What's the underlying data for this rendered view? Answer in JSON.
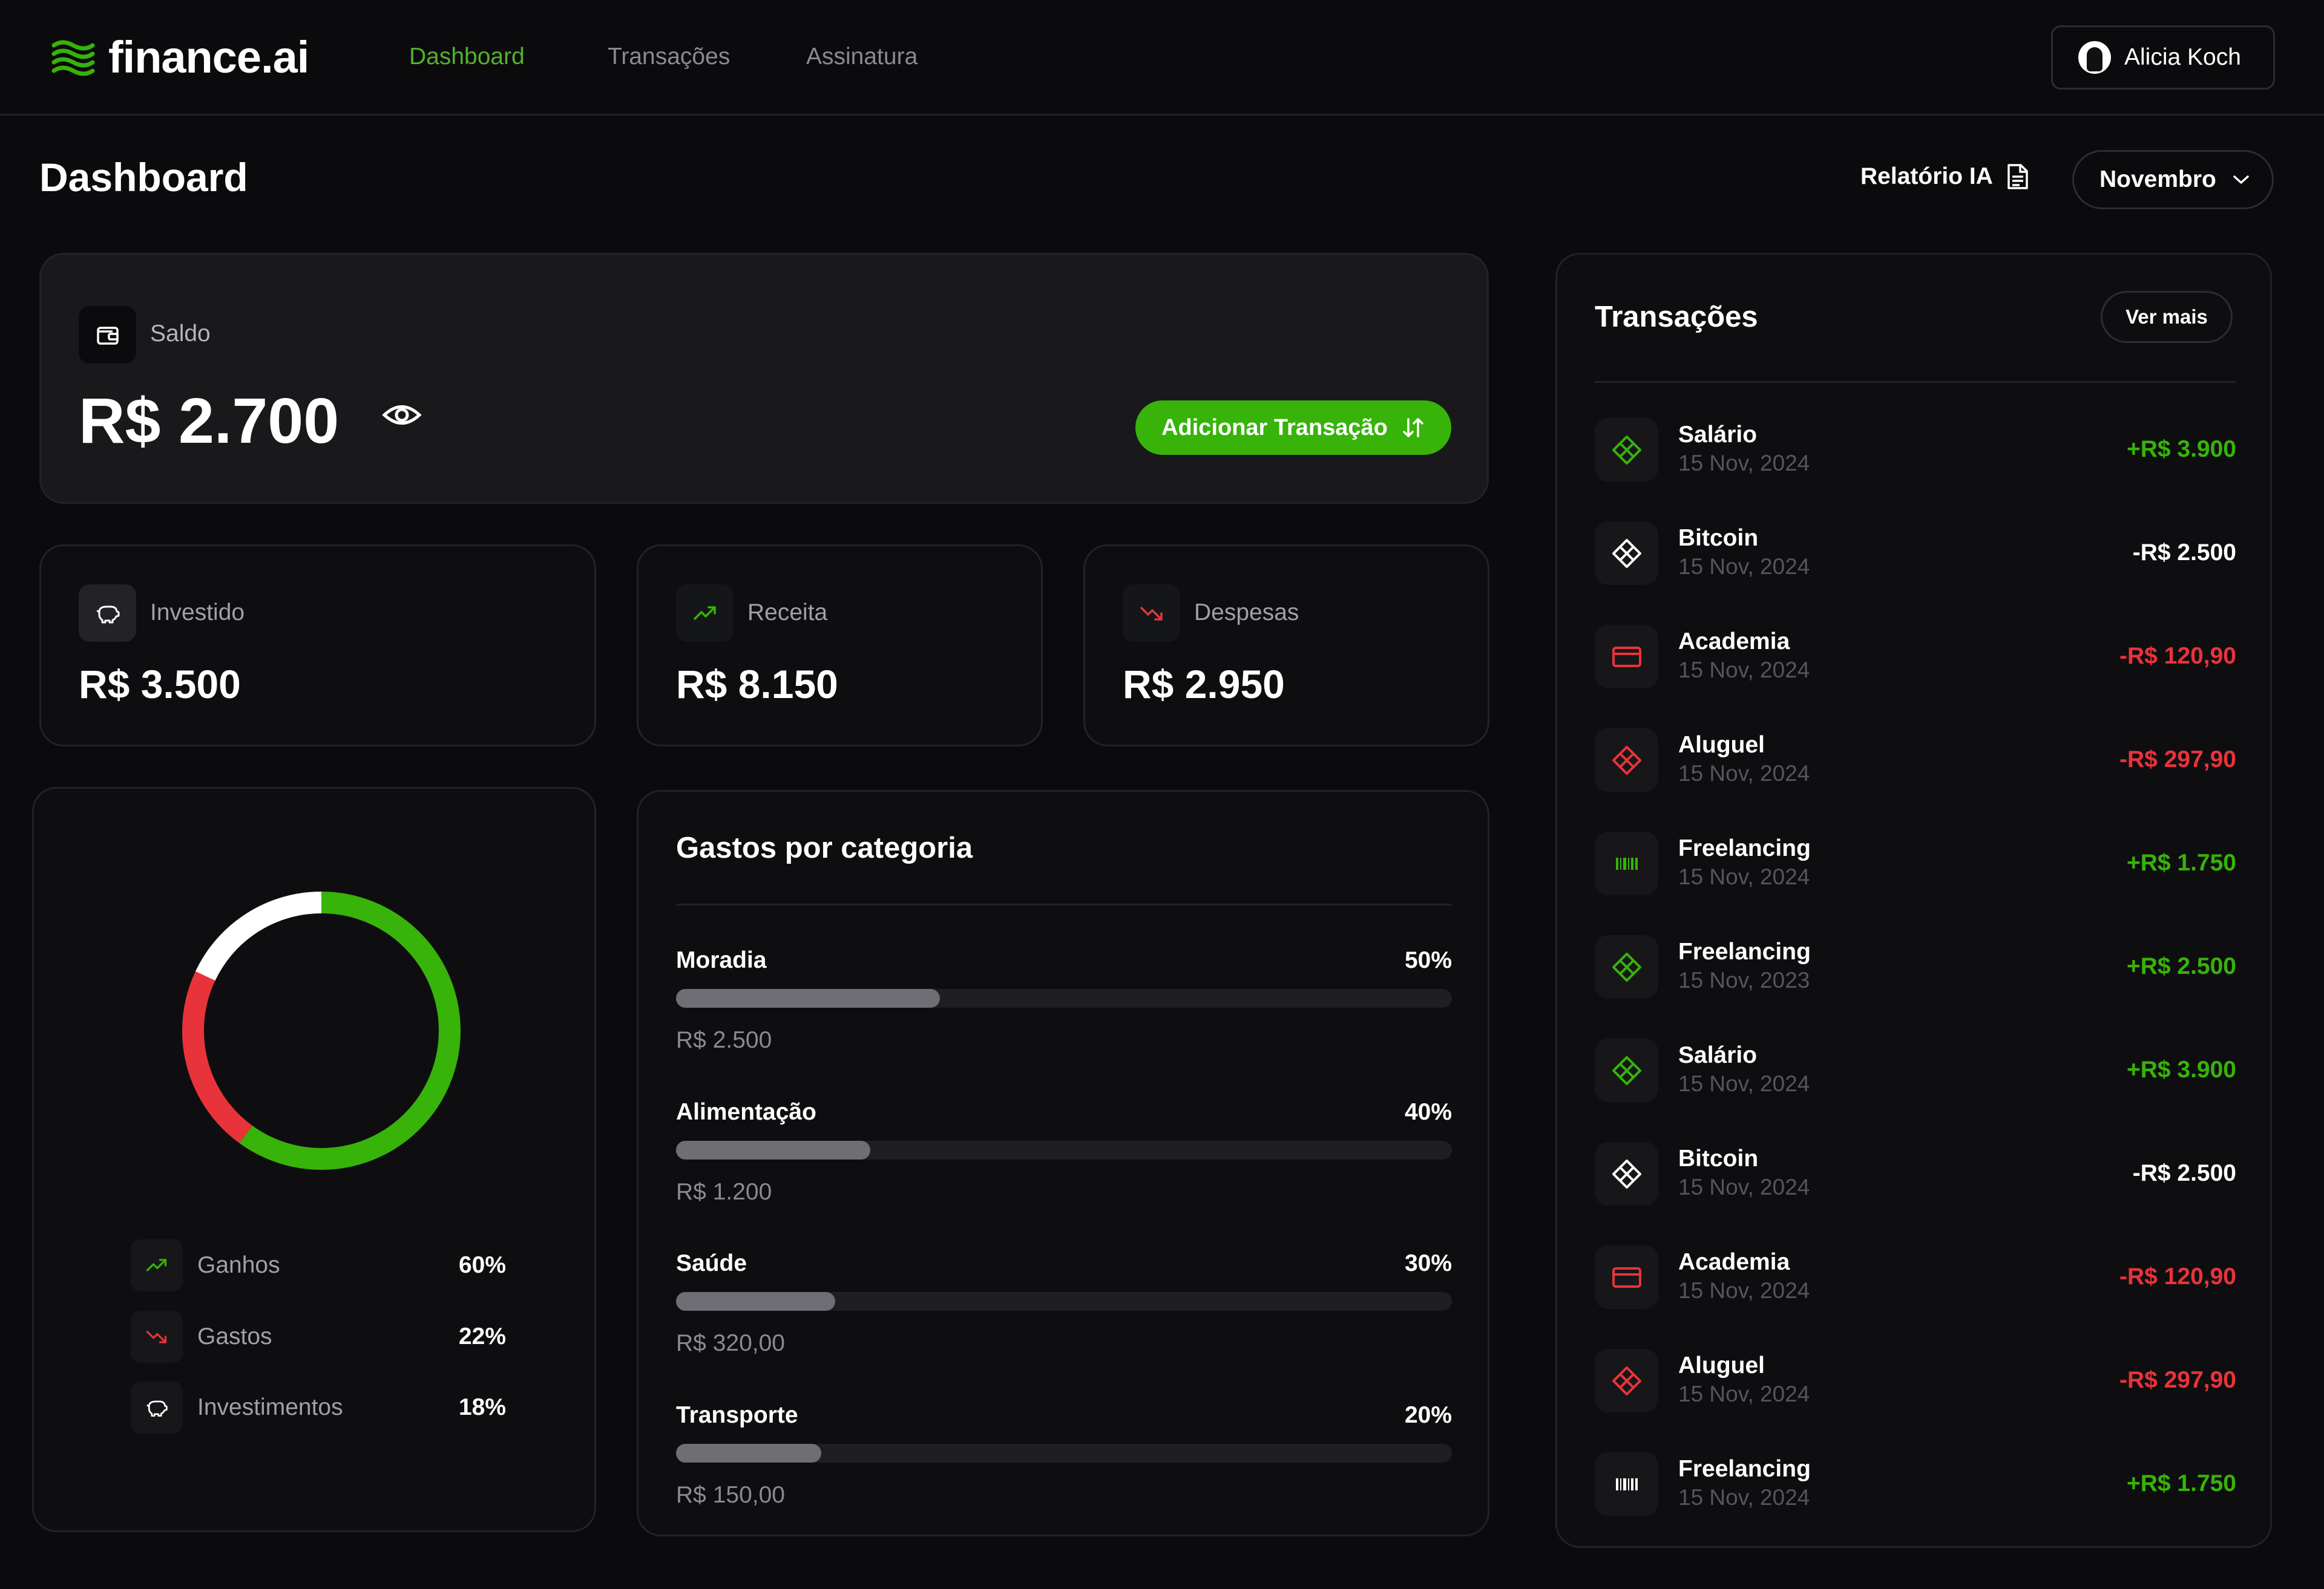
{
  "nav": {
    "logo": "finance.ai",
    "links": [
      "Dashboard",
      "Transações",
      "Assinatura"
    ],
    "user": "Alicia Koch"
  },
  "header": {
    "title": "Dashboard",
    "report_label": "Relatório IA",
    "month": "Novembro"
  },
  "balance": {
    "label": "Saldo",
    "value": "R$ 2.700",
    "add_button": "Adicionar Transação"
  },
  "stats": [
    {
      "label": "Investido",
      "value": "R$ 3.500",
      "icon": "piggy-bank-icon"
    },
    {
      "label": "Receita",
      "value": "R$ 8.150",
      "icon": "trending-up-icon"
    },
    {
      "label": "Despesas",
      "value": "R$ 2.950",
      "icon": "trending-down-icon"
    }
  ],
  "distribution": {
    "legend": [
      {
        "label": "Ganhos",
        "value": "60%"
      },
      {
        "label": "Gastos",
        "value": "22%"
      },
      {
        "label": "Investimentos",
        "value": "18%"
      }
    ]
  },
  "chart_data": {
    "type": "pie",
    "style": "donut",
    "categories": [
      "Ganhos",
      "Gastos",
      "Investimentos"
    ],
    "values": [
      60,
      22,
      18
    ],
    "colors": [
      "#37b30a",
      "#e9333a",
      "#ffffff"
    ]
  },
  "categories": {
    "title": "Gastos por categoria",
    "items": [
      {
        "name": "Moradia",
        "percent": "50%",
        "amount": "R$ 2.500",
        "fill": 0.34
      },
      {
        "name": "Alimentação",
        "percent": "40%",
        "amount": "R$ 1.200",
        "fill": 0.25
      },
      {
        "name": "Saúde",
        "percent": "30%",
        "amount": "R$ 320,00",
        "fill": 0.205
      },
      {
        "name": "Transporte",
        "percent": "20%",
        "amount": "R$ 150,00",
        "fill": 0.187
      }
    ]
  },
  "transactions": {
    "title": "Transações",
    "more": "Ver mais",
    "items": [
      {
        "name": "Salário",
        "date": "15 Nov, 2024",
        "amount": "+R$ 3.900",
        "kind": "pix",
        "color": "#37b30a"
      },
      {
        "name": "Bitcoin",
        "date": "15 Nov, 2024",
        "amount": "-R$ 2.500",
        "kind": "pix",
        "color": "#ffffff"
      },
      {
        "name": "Academia",
        "date": "15 Nov, 2024",
        "amount": "-R$ 120,90",
        "kind": "card",
        "color": "#e9333a"
      },
      {
        "name": "Aluguel",
        "date": "15 Nov, 2024",
        "amount": "-R$ 297,90",
        "kind": "pix",
        "color": "#e9333a"
      },
      {
        "name": "Freelancing",
        "date": "15 Nov, 2024",
        "amount": "+R$ 1.750",
        "kind": "barcode",
        "color": "#37b30a"
      },
      {
        "name": "Freelancing",
        "date": "15 Nov, 2023",
        "amount": "+R$ 2.500",
        "kind": "pix",
        "color": "#37b30a"
      },
      {
        "name": "Salário",
        "date": "15 Nov, 2024",
        "amount": "+R$ 3.900",
        "kind": "pix",
        "color": "#37b30a"
      },
      {
        "name": "Bitcoin",
        "date": "15 Nov, 2024",
        "amount": "-R$ 2.500",
        "kind": "pix",
        "color": "#ffffff"
      },
      {
        "name": "Academia",
        "date": "15 Nov, 2024",
        "amount": "-R$ 120,90",
        "kind": "card",
        "color": "#e9333a"
      },
      {
        "name": "Aluguel",
        "date": "15 Nov, 2024",
        "amount": "-R$ 297,90",
        "kind": "pix",
        "color": "#e9333a"
      },
      {
        "name": "Freelancing",
        "date": "15 Nov, 2024",
        "amount": "+R$ 1.750",
        "kind": "barcode",
        "color": "#ffffff"
      }
    ]
  },
  "colors": {
    "accent": "#37b30a",
    "negative": "#e9333a",
    "positive": "#37b30a"
  }
}
